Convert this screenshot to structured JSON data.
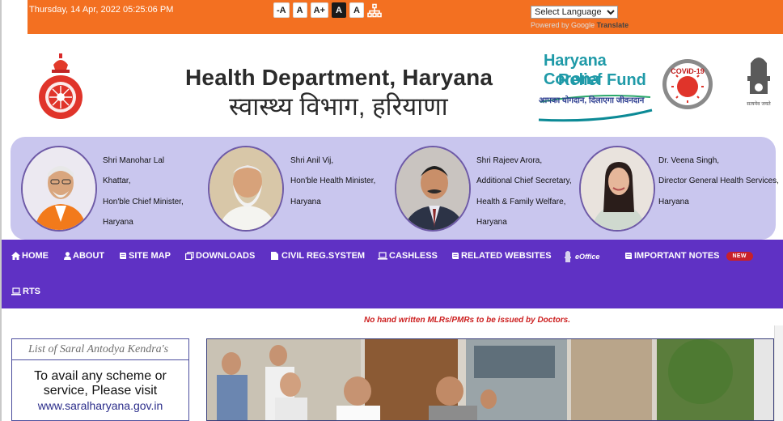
{
  "topbar": {
    "datetime": "Thursday, 14 Apr, 2022 05:25:06 PM",
    "font_buttons": [
      "-A",
      "A",
      "A+",
      "A",
      "A"
    ],
    "language_select": "Select Language",
    "powered_by": "Powered by",
    "google": "Google",
    "translate": "Translate"
  },
  "header": {
    "title_en": "Health Department, Haryana",
    "title_hi": "स्वास्थ्य विभाग, हरियाणा",
    "relief_line1": "Haryana Corona",
    "relief_line2": "Relief Fund",
    "relief_tagline": "आपका योगदान, दिलाएगा जीवनदान",
    "covid_badge": "COVID-19",
    "emblem_motto": "सत्यमेव जयते"
  },
  "leaders": [
    {
      "lines": [
        "Shri Manohar Lal",
        "Khattar,",
        "Hon'ble Chief Minister,",
        "Haryana"
      ]
    },
    {
      "lines": [
        "Shri Anil Vij,",
        "Hon'ble Health Minister,",
        "Haryana"
      ]
    },
    {
      "lines": [
        "Shri Rajeev Arora,",
        "Additional Chief Secretary,",
        "Health & Family Welfare,",
        "Haryana"
      ]
    },
    {
      "lines": [
        "Dr. Veena Singh,",
        "Director General Health Services,",
        "Haryana"
      ]
    }
  ],
  "nav": {
    "home": "HOME",
    "about": "ABOUT",
    "site_map": "SITE MAP",
    "downloads": "DOWNLOADS",
    "civil_reg": "CIVIL REG.SYSTEM",
    "cashless": "CASHLESS",
    "related": "RELATED WEBSITES",
    "eoffice": "eOffice",
    "important": "IMPORTANT NOTES",
    "new_badge": "NEW",
    "rts": "RTS"
  },
  "notice": "No hand written MLRs/PMRs to be issued by Doctors.",
  "saral": {
    "heading": "List of Saral Antodya Kendra's",
    "line1": "To avail any scheme or",
    "line2": "service, Please visit",
    "url": "www.saralharyana.gov.in"
  },
  "colors": {
    "topbar": "#f37021",
    "nav": "#5f31c4",
    "leaders_bg": "#c9c6ee",
    "notice": "#cc1e1e"
  }
}
